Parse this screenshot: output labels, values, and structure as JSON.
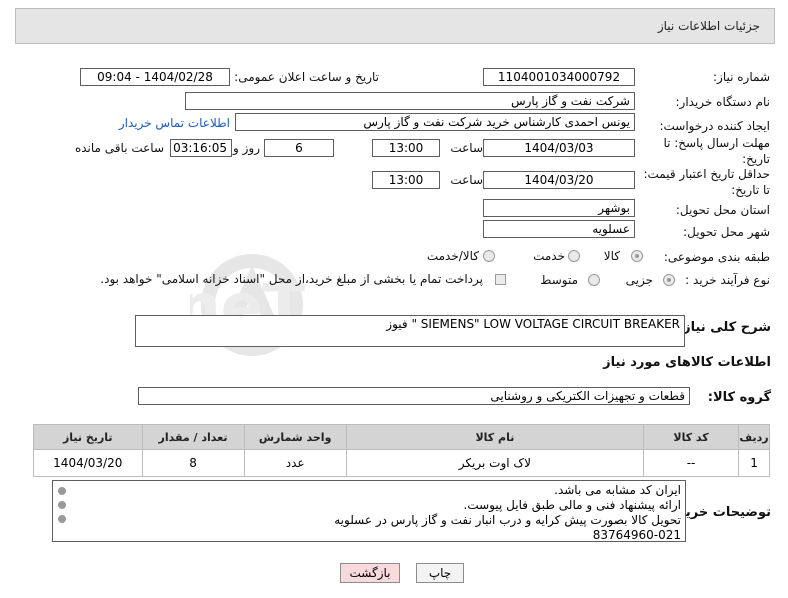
{
  "header": {
    "title": "جزئیات اطلاعات نیاز"
  },
  "fields": {
    "need_number_label": "شماره نیاز:",
    "need_number": "1104001034000792",
    "announce_label": "تاریخ و ساعت اعلان عمومی:",
    "announce_value": "1404/02/28 - 09:04",
    "buyer_org_label": "نام دستگاه خریدار:",
    "buyer_org": "شرکت نفت و گاز پارس",
    "creator_label": "ایجاد کننده درخواست:",
    "creator": "یونس احمدی کارشناس خرید شرکت نفت و گاز پارس",
    "contact_link": "اطلاعات تماس خریدار",
    "reply_deadline_label_1": "مهلت ارسال پاسخ: تا",
    "reply_deadline_label_2": "تاریخ:",
    "reply_date": "1404/03/03",
    "time_label": "ساعت",
    "reply_time": "13:00",
    "days_value": "6",
    "days_label": "روز و",
    "remaining_value": "03:16:05",
    "remaining_label": "ساعت باقی مانده",
    "validity_label_1": "حداقل تاریخ اعتبار قیمت:",
    "validity_label_2": "تا تاریخ:",
    "validity_date": "1404/03/20",
    "validity_time": "13:00",
    "province_label": "استان محل تحویل:",
    "province": "بوشهر",
    "city_label": "شهر محل تحویل:",
    "city": "عسلویه",
    "category_label": "طبقه بندی موضوعی:",
    "category_options": [
      "کالا",
      "خدمت",
      "کالا/خدمت"
    ],
    "process_label": "نوع فرآیند خرید :",
    "process_options": [
      "جزیی",
      "متوسط"
    ],
    "payment_note": "پرداخت تمام یا بخشی از مبلغ خرید،از محل \"اسناد خزانه اسلامی\" خواهد بود.",
    "description_label": "شرح کلی نیاز:",
    "description": "فیوز  \" SIEMENS\" LOW VOLTAGE CIRCUIT BREAKER",
    "goods_info_title": "اطلاعات کالاهای مورد نیاز",
    "goods_group_label": "گروه کالا:",
    "goods_group": "قطعات و تجهیزات الکتریکی و روشنایی"
  },
  "table": {
    "headers": [
      "ردیف",
      "کد کالا",
      "نام کالا",
      "واحد شمارش",
      "تعداد / مقدار",
      "تاریخ نیاز"
    ],
    "rows": [
      [
        "1",
        "--",
        "لاک اوت بریکر",
        "عدد",
        "8",
        "1404/03/20"
      ]
    ]
  },
  "buyer_notes": {
    "label": "توضیحات خریدار:",
    "lines": [
      "ایران کد مشابه می باشد.",
      "ارائه پیشنهاد فنی و مالی طبق فایل پیوست.",
      "تحویل کالا بصورت پیش کرایه و درب انبار نفت و گاز پارس در عسلویه",
      "83764960-021"
    ]
  },
  "buttons": {
    "print": "چاپ",
    "back": "بازگشت"
  },
  "watermark": {
    "text": "AriaTender.neT"
  },
  "colors": {
    "link": "#1a5bc4",
    "back_button_bg": "#f8d9dc",
    "header_bg": "#e5e5e5",
    "table_header_bg": "#d4d4d4"
  }
}
